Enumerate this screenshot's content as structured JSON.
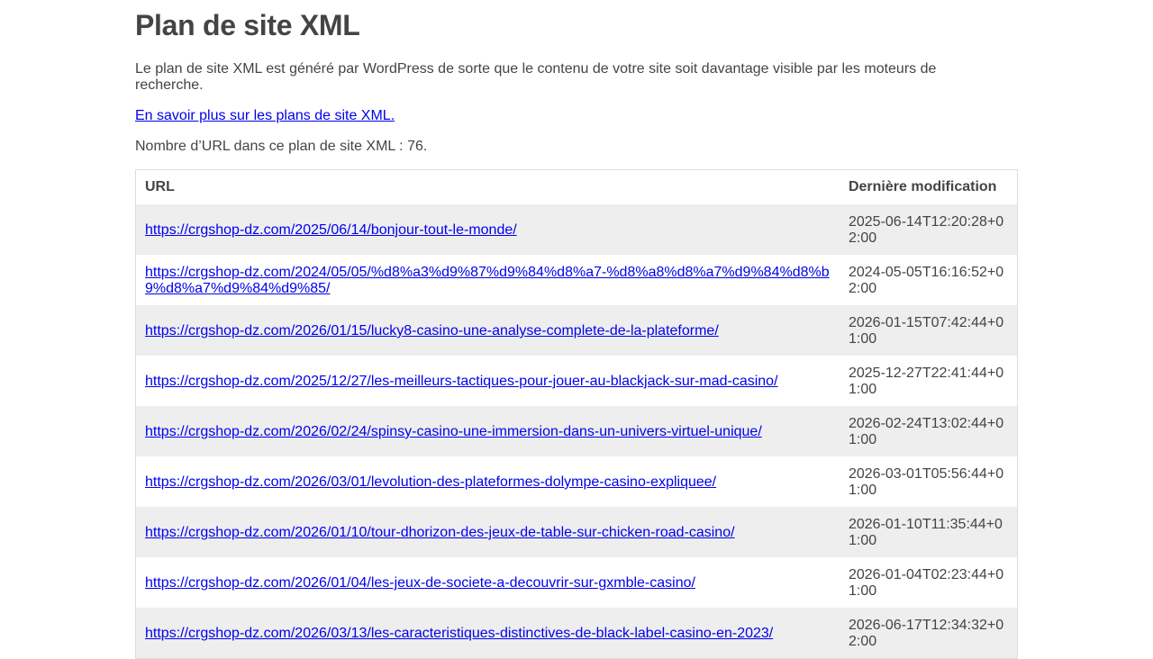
{
  "page": {
    "title": "Plan de site XML",
    "description": "Le plan de site XML est généré par WordPress de sorte que le contenu de votre site soit davantage visible par les moteurs de recherche.",
    "learn_more": "En savoir plus sur les plans de site XML.",
    "url_count": "Nombre d’URL dans ce plan de site XML : 76."
  },
  "table": {
    "headers": {
      "url": "URL",
      "lastmod": "Dernière modification"
    },
    "rows": [
      {
        "url": "https://crgshop-dz.com/2025/06/14/bonjour-tout-le-monde/",
        "lastmod": "2025-06-14T12:20:28+02:00"
      },
      {
        "url": "https://crgshop-dz.com/2024/05/05/%d8%a3%d9%87%d9%84%d8%a7-%d8%a8%d8%a7%d9%84%d8%b9%d8%a7%d9%84%d9%85/",
        "lastmod": "2024-05-05T16:16:52+02:00"
      },
      {
        "url": "https://crgshop-dz.com/2026/01/15/lucky8-casino-une-analyse-complete-de-la-plateforme/",
        "lastmod": "2026-01-15T07:42:44+01:00"
      },
      {
        "url": "https://crgshop-dz.com/2025/12/27/les-meilleurs-tactiques-pour-jouer-au-blackjack-sur-mad-casino/",
        "lastmod": "2025-12-27T22:41:44+01:00"
      },
      {
        "url": "https://crgshop-dz.com/2026/02/24/spinsy-casino-une-immersion-dans-un-univers-virtuel-unique/",
        "lastmod": "2026-02-24T13:02:44+01:00"
      },
      {
        "url": "https://crgshop-dz.com/2026/03/01/levolution-des-plateformes-dolympe-casino-expliquee/",
        "lastmod": "2026-03-01T05:56:44+01:00"
      },
      {
        "url": "https://crgshop-dz.com/2026/01/10/tour-dhorizon-des-jeux-de-table-sur-chicken-road-casino/",
        "lastmod": "2026-01-10T11:35:44+01:00"
      },
      {
        "url": "https://crgshop-dz.com/2026/01/04/les-jeux-de-societe-a-decouvrir-sur-gxmble-casino/",
        "lastmod": "2026-01-04T02:23:44+01:00"
      },
      {
        "url": "https://crgshop-dz.com/2026/03/13/les-caracteristiques-distinctives-de-black-label-casino-en-2023/",
        "lastmod": "2026-06-17T12:34:32+02:00"
      }
    ]
  }
}
